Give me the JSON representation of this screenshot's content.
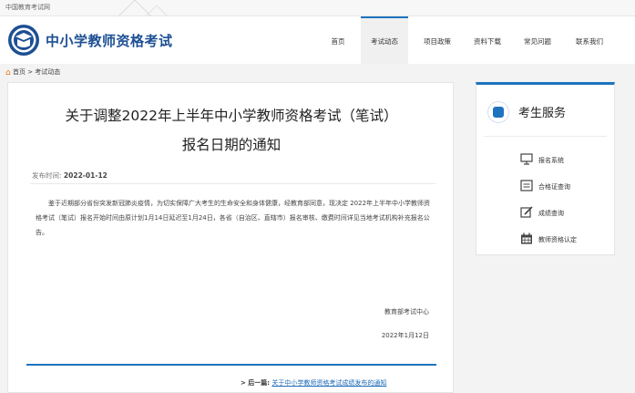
{
  "topbar": {
    "site_name": "中国教育考试网"
  },
  "header": {
    "brand": "中小学教师资格考试",
    "nav": [
      "首页",
      "考试动态",
      "项目政策",
      "资料下载",
      "常见问题",
      "联系我们"
    ],
    "active_index": 1
  },
  "breadcrumb": {
    "home": "首页",
    "sep": ">",
    "current": "考试动态"
  },
  "article": {
    "title_line1": "关于调整2022年上半年中小学教师资格考试（笔试）",
    "title_line2": "报名日期的通知",
    "date_label": "发布时间:",
    "date_value": "2022-01-12",
    "body": "鉴于近期部分省份突发新冠肺炎疫情，为切实保障广大考生的生命安全和身体健康，经教育部同意，现决定 2022年上半年中小学教师资格考试（笔试）报名开始时间由原计划1月14日延迟至1月24日，各省（自治区、直辖市）报名审核、缴费时间详见当地考试机构补充报名公告。",
    "signature": "教育部考试中心",
    "sign_date": "2022年1月12日",
    "next_label": "> 后一篇:",
    "next_link": "关于中小学教师资格考试成绩发布的通知"
  },
  "side": {
    "title": "考生服务",
    "services": [
      {
        "label": "报名系统",
        "icon": "monitor-icon"
      },
      {
        "label": "合格证查询",
        "icon": "certificate-icon"
      },
      {
        "label": "成绩查询",
        "icon": "edit-icon"
      },
      {
        "label": "教师资格认定",
        "icon": "calendar-icon"
      }
    ]
  },
  "colors": {
    "brand": "#1d4f93",
    "accent": "#1e73be",
    "home_icon": "#e8781a"
  }
}
